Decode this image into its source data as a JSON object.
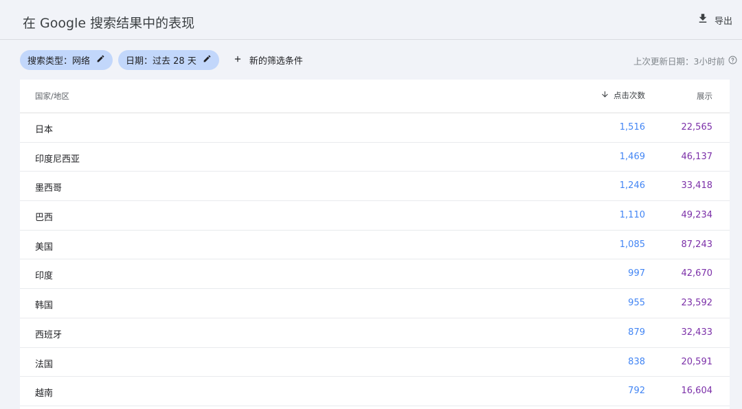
{
  "header": {
    "title": "在 Google 搜索结果中的表现",
    "export_label": "导出"
  },
  "filters": {
    "search_type": "搜索类型：网络",
    "date": "日期：过去 28 天",
    "add_filter": "新的筛选条件",
    "last_updated": "上次更新日期：3小时前"
  },
  "table": {
    "columns": {
      "country": "国家/地区",
      "clicks": "点击次数",
      "impressions": "展示"
    },
    "rows": [
      {
        "country": "日本",
        "clicks": "1,516",
        "impressions": "22,565"
      },
      {
        "country": "印度尼西亚",
        "clicks": "1,469",
        "impressions": "46,137"
      },
      {
        "country": "墨西哥",
        "clicks": "1,246",
        "impressions": "33,418"
      },
      {
        "country": "巴西",
        "clicks": "1,110",
        "impressions": "49,234"
      },
      {
        "country": "美国",
        "clicks": "1,085",
        "impressions": "87,243"
      },
      {
        "country": "印度",
        "clicks": "997",
        "impressions": "42,670"
      },
      {
        "country": "韩国",
        "clicks": "955",
        "impressions": "23,592"
      },
      {
        "country": "西班牙",
        "clicks": "879",
        "impressions": "32,433"
      },
      {
        "country": "法国",
        "clicks": "838",
        "impressions": "20,591"
      },
      {
        "country": "越南",
        "clicks": "792",
        "impressions": "16,604"
      }
    ]
  },
  "colors": {
    "clicks": "#4285f4",
    "impressions": "#7b2fa8",
    "chip": "#c2d7fb"
  }
}
